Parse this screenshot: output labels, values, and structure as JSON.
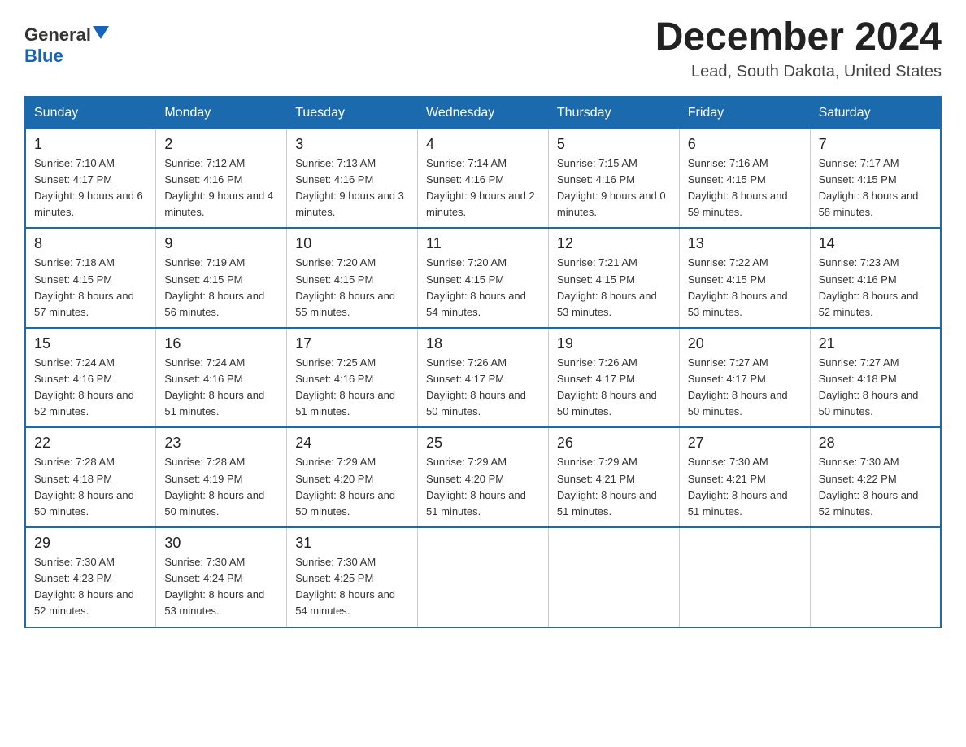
{
  "header": {
    "logo_general": "General",
    "logo_blue": "Blue",
    "title": "December 2024",
    "subtitle": "Lead, South Dakota, United States"
  },
  "days_of_week": [
    "Sunday",
    "Monday",
    "Tuesday",
    "Wednesday",
    "Thursday",
    "Friday",
    "Saturday"
  ],
  "weeks": [
    [
      {
        "num": "1",
        "sunrise": "7:10 AM",
        "sunset": "4:17 PM",
        "daylight": "9 hours and 6 minutes."
      },
      {
        "num": "2",
        "sunrise": "7:12 AM",
        "sunset": "4:16 PM",
        "daylight": "9 hours and 4 minutes."
      },
      {
        "num": "3",
        "sunrise": "7:13 AM",
        "sunset": "4:16 PM",
        "daylight": "9 hours and 3 minutes."
      },
      {
        "num": "4",
        "sunrise": "7:14 AM",
        "sunset": "4:16 PM",
        "daylight": "9 hours and 2 minutes."
      },
      {
        "num": "5",
        "sunrise": "7:15 AM",
        "sunset": "4:16 PM",
        "daylight": "9 hours and 0 minutes."
      },
      {
        "num": "6",
        "sunrise": "7:16 AM",
        "sunset": "4:15 PM",
        "daylight": "8 hours and 59 minutes."
      },
      {
        "num": "7",
        "sunrise": "7:17 AM",
        "sunset": "4:15 PM",
        "daylight": "8 hours and 58 minutes."
      }
    ],
    [
      {
        "num": "8",
        "sunrise": "7:18 AM",
        "sunset": "4:15 PM",
        "daylight": "8 hours and 57 minutes."
      },
      {
        "num": "9",
        "sunrise": "7:19 AM",
        "sunset": "4:15 PM",
        "daylight": "8 hours and 56 minutes."
      },
      {
        "num": "10",
        "sunrise": "7:20 AM",
        "sunset": "4:15 PM",
        "daylight": "8 hours and 55 minutes."
      },
      {
        "num": "11",
        "sunrise": "7:20 AM",
        "sunset": "4:15 PM",
        "daylight": "8 hours and 54 minutes."
      },
      {
        "num": "12",
        "sunrise": "7:21 AM",
        "sunset": "4:15 PM",
        "daylight": "8 hours and 53 minutes."
      },
      {
        "num": "13",
        "sunrise": "7:22 AM",
        "sunset": "4:15 PM",
        "daylight": "8 hours and 53 minutes."
      },
      {
        "num": "14",
        "sunrise": "7:23 AM",
        "sunset": "4:16 PM",
        "daylight": "8 hours and 52 minutes."
      }
    ],
    [
      {
        "num": "15",
        "sunrise": "7:24 AM",
        "sunset": "4:16 PM",
        "daylight": "8 hours and 52 minutes."
      },
      {
        "num": "16",
        "sunrise": "7:24 AM",
        "sunset": "4:16 PM",
        "daylight": "8 hours and 51 minutes."
      },
      {
        "num": "17",
        "sunrise": "7:25 AM",
        "sunset": "4:16 PM",
        "daylight": "8 hours and 51 minutes."
      },
      {
        "num": "18",
        "sunrise": "7:26 AM",
        "sunset": "4:17 PM",
        "daylight": "8 hours and 50 minutes."
      },
      {
        "num": "19",
        "sunrise": "7:26 AM",
        "sunset": "4:17 PM",
        "daylight": "8 hours and 50 minutes."
      },
      {
        "num": "20",
        "sunrise": "7:27 AM",
        "sunset": "4:17 PM",
        "daylight": "8 hours and 50 minutes."
      },
      {
        "num": "21",
        "sunrise": "7:27 AM",
        "sunset": "4:18 PM",
        "daylight": "8 hours and 50 minutes."
      }
    ],
    [
      {
        "num": "22",
        "sunrise": "7:28 AM",
        "sunset": "4:18 PM",
        "daylight": "8 hours and 50 minutes."
      },
      {
        "num": "23",
        "sunrise": "7:28 AM",
        "sunset": "4:19 PM",
        "daylight": "8 hours and 50 minutes."
      },
      {
        "num": "24",
        "sunrise": "7:29 AM",
        "sunset": "4:20 PM",
        "daylight": "8 hours and 50 minutes."
      },
      {
        "num": "25",
        "sunrise": "7:29 AM",
        "sunset": "4:20 PM",
        "daylight": "8 hours and 51 minutes."
      },
      {
        "num": "26",
        "sunrise": "7:29 AM",
        "sunset": "4:21 PM",
        "daylight": "8 hours and 51 minutes."
      },
      {
        "num": "27",
        "sunrise": "7:30 AM",
        "sunset": "4:21 PM",
        "daylight": "8 hours and 51 minutes."
      },
      {
        "num": "28",
        "sunrise": "7:30 AM",
        "sunset": "4:22 PM",
        "daylight": "8 hours and 52 minutes."
      }
    ],
    [
      {
        "num": "29",
        "sunrise": "7:30 AM",
        "sunset": "4:23 PM",
        "daylight": "8 hours and 52 minutes."
      },
      {
        "num": "30",
        "sunrise": "7:30 AM",
        "sunset": "4:24 PM",
        "daylight": "8 hours and 53 minutes."
      },
      {
        "num": "31",
        "sunrise": "7:30 AM",
        "sunset": "4:25 PM",
        "daylight": "8 hours and 54 minutes."
      },
      null,
      null,
      null,
      null
    ]
  ],
  "labels": {
    "sunrise": "Sunrise:",
    "sunset": "Sunset:",
    "daylight": "Daylight:"
  }
}
